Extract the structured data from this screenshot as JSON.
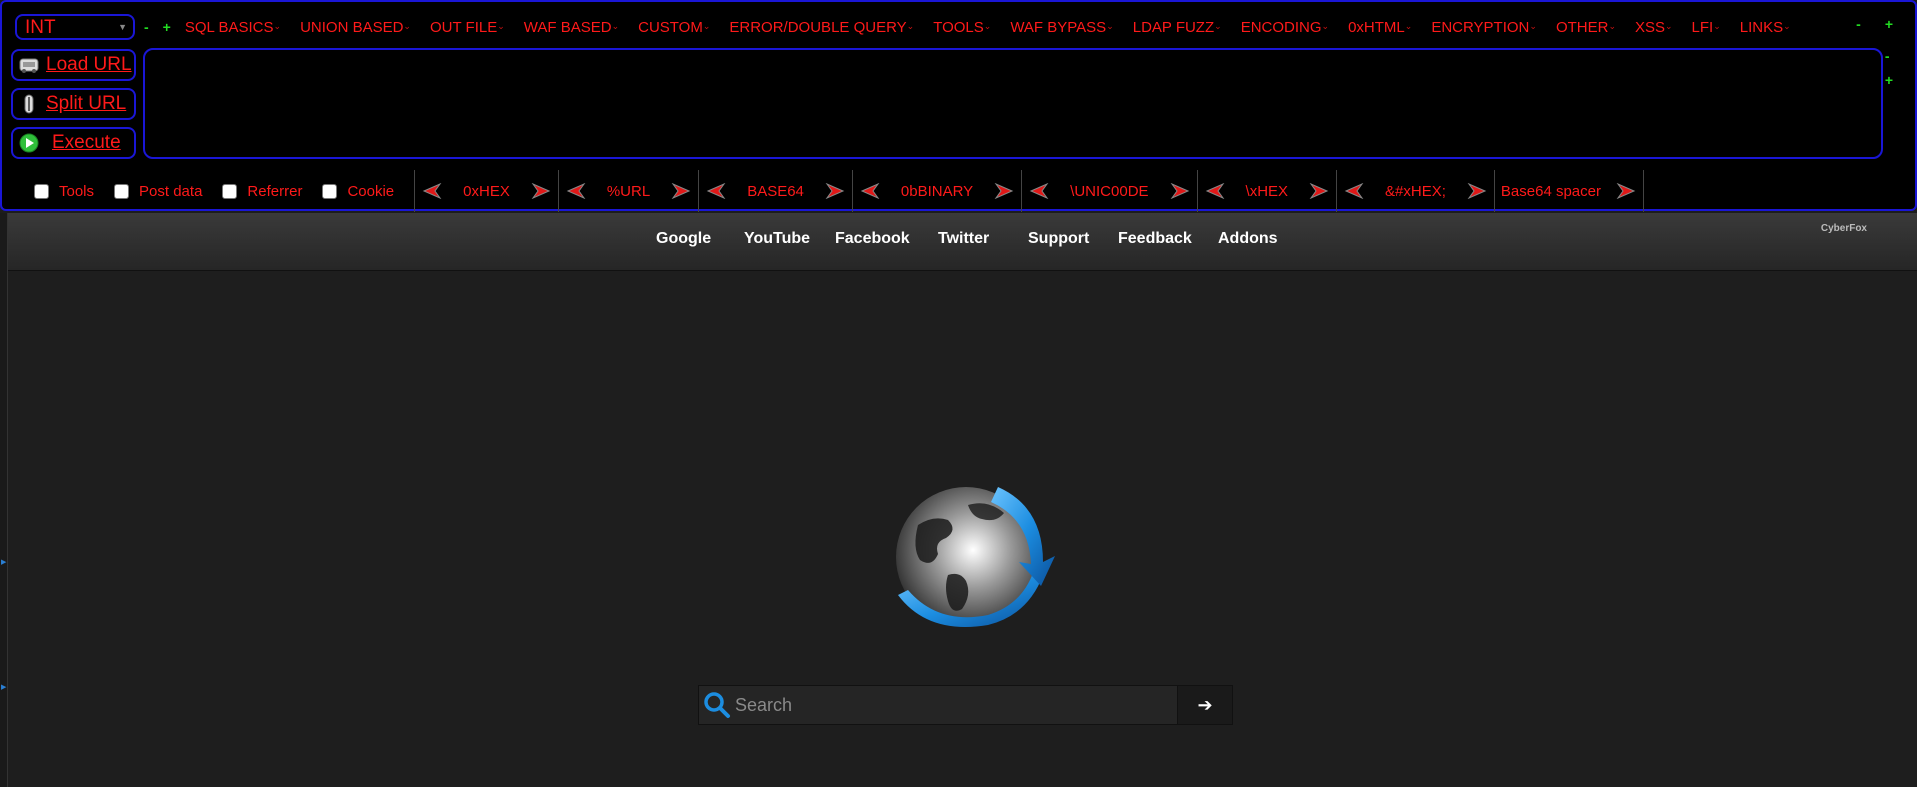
{
  "hackbar": {
    "level": "INT",
    "buttons": {
      "load": "Load URL",
      "split": "Split URL",
      "execute": "Execute"
    },
    "green_controls": [
      "-",
      "+"
    ],
    "menu": [
      "SQL BASICS",
      "UNION BASED",
      "OUT FILE",
      "WAF BASED",
      "CUSTOM",
      "ERROR/DOUBLE QUERY",
      "TOOLS",
      "WAF BYPASS",
      "LDAP FUZZ",
      "ENCODING",
      "0xHTML",
      "ENCRYPTION",
      "OTHER",
      "XSS",
      "LFI",
      "LINKS"
    ],
    "url_value": "",
    "checkboxes": [
      "Tools",
      "Post data",
      "Referrer",
      "Cookie"
    ],
    "encoders": [
      "0xHEX",
      "%URL",
      "BASE64",
      "0bBINARY",
      "\\UNIC00DE",
      "\\xHEX",
      "&#xHEX;",
      "Base64 spacer"
    ]
  },
  "nav": {
    "links": [
      "Google",
      "YouTube",
      "Facebook",
      "Twitter",
      "Support",
      "Feedback",
      "Addons"
    ],
    "brand": "CyberFox"
  },
  "search": {
    "placeholder": "Search",
    "go_symbol": "➔"
  },
  "colors": {
    "accent_red": "#ff1a1a",
    "border_blue": "#1a16d6",
    "green": "#22dd22",
    "globe_blue": "#1c8de0"
  }
}
